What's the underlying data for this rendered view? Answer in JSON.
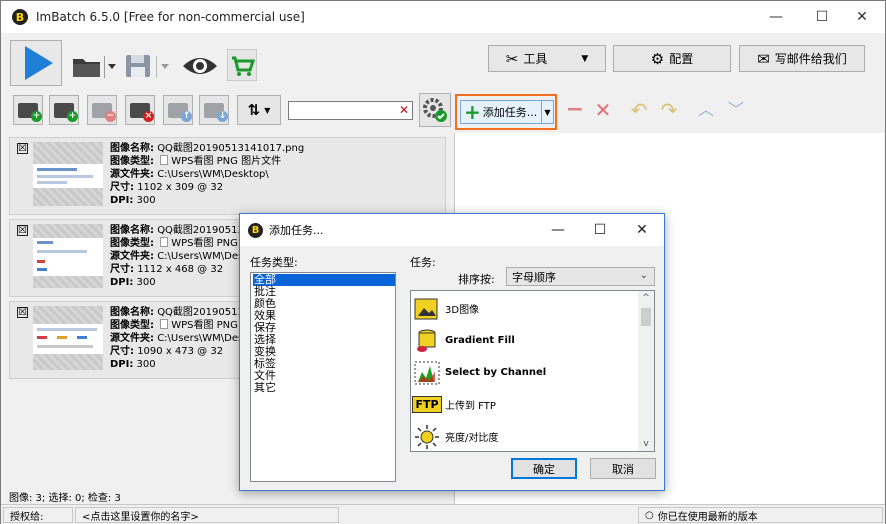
{
  "app": {
    "title": "ImBatch 6.5.0 [Free for non-commercial use]",
    "logo_letter": "B"
  },
  "window_controls": {
    "minimize": "—",
    "maximize": "☐",
    "close": "✕"
  },
  "toolbar": {
    "tools_label": "工具",
    "config_label": "配置",
    "email_label": "写邮件给我们"
  },
  "filter": {
    "value": "",
    "clear_glyph": "✕"
  },
  "task_toolbar": {
    "add_task_label": "添加任务..."
  },
  "images": [
    {
      "name_label": "图像名称:",
      "name": "QQ截图20190513141017.png",
      "type_label": "图像类型:",
      "type": "WPS看图 PNG 图片文件",
      "folder_label": "源文件夹:",
      "folder": "C:\\Users\\WM\\Desktop\\",
      "size_label": "尺寸:",
      "size": "1102 x 309 @ 32",
      "dpi_label": "DPI:",
      "dpi": "300",
      "checked": "☒"
    },
    {
      "name_label": "图像名称:",
      "name": "QQ截图20190513",
      "type_label": "图像类型:",
      "type": "WPS看图 PNG",
      "folder_label": "源文件夹:",
      "folder": "C:\\Users\\WM\\Des",
      "size_label": "尺寸:",
      "size": "1112 x 468 @ 32",
      "dpi_label": "DPI:",
      "dpi": "300",
      "checked": "☒"
    },
    {
      "name_label": "图像名称:",
      "name": "QQ截图20190513",
      "type_label": "图像类型:",
      "type": "WPS看图 PNG",
      "folder_label": "源文件夹:",
      "folder": "C:\\Users\\WM\\Des",
      "size_label": "尺寸:",
      "size": "1090 x 473 @ 32",
      "dpi_label": "DPI:",
      "dpi": "300",
      "checked": "☒"
    }
  ],
  "footer": {
    "counts": "图像: 3; 选择: 0; 检查: 3"
  },
  "statusbar": {
    "license_label": "授权给:",
    "license_value": "<点击这里设置你的名字>",
    "version_status": "你已在使用最新的版本"
  },
  "dialog": {
    "title": "添加任务...",
    "task_type_label": "任务类型:",
    "task_label": "任务:",
    "sort_label": "排序按:",
    "sort_value": "字母顺序",
    "task_types": [
      "全部",
      "批注",
      "颜色",
      "效果",
      "保存",
      "选择",
      "变换",
      "标签",
      "文件",
      "其它"
    ],
    "selected_type_index": 0,
    "tasks": [
      {
        "label": "3D图像",
        "icon": "3d-image-icon"
      },
      {
        "label": "Gradient Fill",
        "icon": "gradient-fill-icon"
      },
      {
        "label": "Select by Channel",
        "icon": "select-by-channel-icon"
      },
      {
        "label": "上传到 FTP",
        "icon": "ftp-icon",
        "icon_text": "FTP"
      },
      {
        "label": "亮度/对比度",
        "icon": "brightness-contrast-icon"
      }
    ],
    "ok_label": "确定",
    "cancel_label": "取消"
  },
  "colors": {
    "accent_blue": "#1f7fd6",
    "highlight_orange": "#f07020",
    "selection_blue": "#0a64d8",
    "add_green": "#1a9a2a",
    "remove_red": "#d64545"
  }
}
